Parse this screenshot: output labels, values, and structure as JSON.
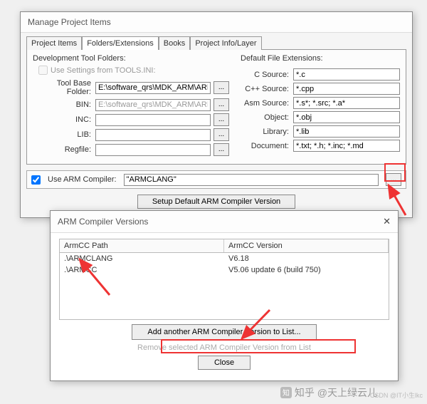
{
  "window1": {
    "title": "Manage Project Items",
    "tabs": [
      "Project Items",
      "Folders/Extensions",
      "Books",
      "Project Info/Layer"
    ],
    "active_tab": 1,
    "dev_label": "Development Tool Folders:",
    "use_settings": "Use Settings from TOOLS.INI:",
    "fields": {
      "tool_base": {
        "label": "Tool Base Folder:",
        "value": "E:\\software_qrs\\MDK_ARM\\ARM\\"
      },
      "bin": {
        "label": "BIN:",
        "value": "E:\\software_qrs\\MDK_ARM\\ARM\\BIN\\"
      },
      "inc": {
        "label": "INC:",
        "value": ""
      },
      "lib": {
        "label": "LIB:",
        "value": ""
      },
      "regfile": {
        "label": "Regfile:",
        "value": ""
      }
    },
    "ext_label": "Default File Extensions:",
    "ext": {
      "csrc": {
        "label": "C Source:",
        "value": "*.c"
      },
      "cpp": {
        "label": "C++ Source:",
        "value": "*.cpp"
      },
      "asm": {
        "label": "Asm Source:",
        "value": "*.s*; *.src; *.a*"
      },
      "obj": {
        "label": "Object:",
        "value": "*.obj"
      },
      "library": {
        "label": "Library:",
        "value": "*.lib"
      },
      "doc": {
        "label": "Document:",
        "value": "*.txt; *.h; *.inc; *.md"
      }
    },
    "compiler": {
      "checkbox": "Use ARM Compiler:",
      "value": "\"ARMCLANG\"",
      "setup_btn": "Setup Default ARM Compiler Version"
    }
  },
  "window2": {
    "title": "ARM Compiler Versions",
    "col1": "ArmCC Path",
    "col2": "ArmCC Version",
    "rows": [
      {
        "path": ".\\ARMCLANG",
        "ver": "V6.18"
      },
      {
        "path": ".\\ARMCC",
        "ver": "V5.06 update 6 (build 750)"
      }
    ],
    "add_btn": "Add another ARM Compiler Version to List...",
    "remove_btn": "Remove selected ARM Compiler Version from List",
    "close_btn": "Close"
  },
  "watermark": {
    "zhihu": "知乎 @天上绿云儿",
    "csdn": "CSDN @IT小生lkc"
  }
}
